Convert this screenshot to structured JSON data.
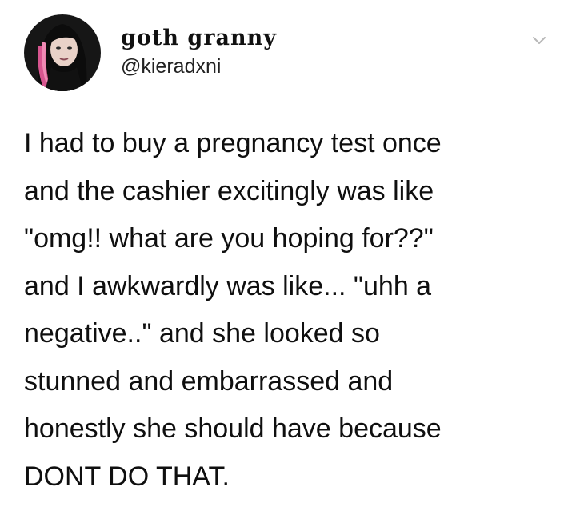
{
  "tweet": {
    "author": {
      "display_name": "goth granny",
      "handle": "@kieradxni",
      "avatar_icon": "profile-avatar"
    },
    "menu_icon": "chevron-down-icon",
    "text_lines": [
      "I had to buy a pregnancy test once",
      "and the cashier excitingly was like",
      "\"omg!! what are you hoping for??\"",
      "and I awkwardly was like... \"uhh a",
      "negative..\" and she looked so",
      "stunned and embarrassed and",
      "honestly she should have because",
      "DONT DO THAT."
    ]
  },
  "colors": {
    "text": "#0f0f0f",
    "chevron": "#b8b8b8",
    "avatar_hair_accent": "#d7558f"
  }
}
